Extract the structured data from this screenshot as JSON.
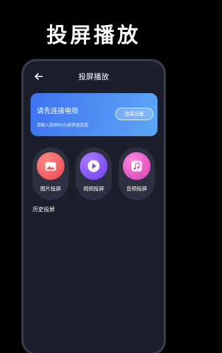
{
  "banner": {
    "title": "投屏播放"
  },
  "screen": {
    "title": "投屏播放",
    "back_icon": "back-arrow-icon"
  },
  "connect_card": {
    "heading": "请先连接电视",
    "subtext": "请输入投屏码/扫描快速连接",
    "button_label": "连接设备"
  },
  "tiles": [
    {
      "label": "图片投屏",
      "icon": "image-icon",
      "color": "#f0555c"
    },
    {
      "label": "视频投屏",
      "icon": "play-icon",
      "color": "#7d4dfa"
    },
    {
      "label": "音频投屏",
      "icon": "music-note-icon",
      "color": "#ec4fc2"
    }
  ],
  "history": {
    "title": "历史投屏"
  },
  "colors": {
    "background": "#000000",
    "screen_bg": "#1c1e2c",
    "card_gradient_start": "#3f73f0",
    "card_gradient_end": "#5da6f5",
    "tile_bg": "#2c3040"
  }
}
